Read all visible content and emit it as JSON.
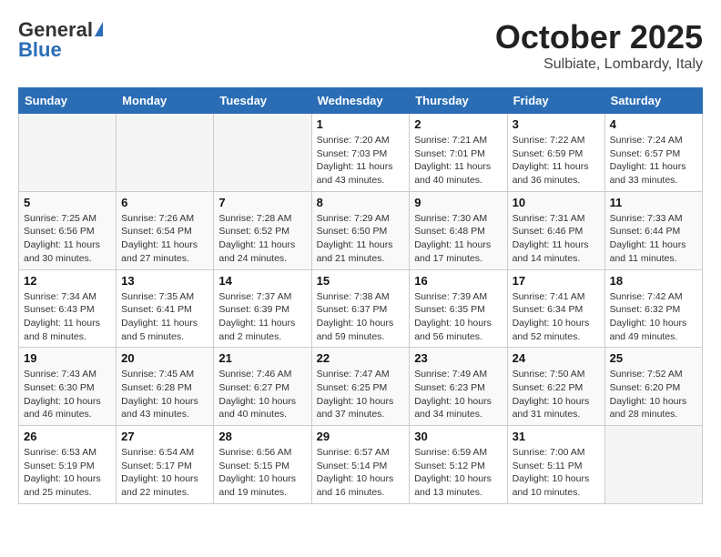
{
  "header": {
    "logo_general": "General",
    "logo_blue": "Blue",
    "month_title": "October 2025",
    "location": "Sulbiate, Lombardy, Italy"
  },
  "weekdays": [
    "Sunday",
    "Monday",
    "Tuesday",
    "Wednesday",
    "Thursday",
    "Friday",
    "Saturday"
  ],
  "weeks": [
    [
      {
        "day": "",
        "sunrise": "",
        "sunset": "",
        "daylight": ""
      },
      {
        "day": "",
        "sunrise": "",
        "sunset": "",
        "daylight": ""
      },
      {
        "day": "",
        "sunrise": "",
        "sunset": "",
        "daylight": ""
      },
      {
        "day": "1",
        "sunrise": "Sunrise: 7:20 AM",
        "sunset": "Sunset: 7:03 PM",
        "daylight": "Daylight: 11 hours and 43 minutes."
      },
      {
        "day": "2",
        "sunrise": "Sunrise: 7:21 AM",
        "sunset": "Sunset: 7:01 PM",
        "daylight": "Daylight: 11 hours and 40 minutes."
      },
      {
        "day": "3",
        "sunrise": "Sunrise: 7:22 AM",
        "sunset": "Sunset: 6:59 PM",
        "daylight": "Daylight: 11 hours and 36 minutes."
      },
      {
        "day": "4",
        "sunrise": "Sunrise: 7:24 AM",
        "sunset": "Sunset: 6:57 PM",
        "daylight": "Daylight: 11 hours and 33 minutes."
      }
    ],
    [
      {
        "day": "5",
        "sunrise": "Sunrise: 7:25 AM",
        "sunset": "Sunset: 6:56 PM",
        "daylight": "Daylight: 11 hours and 30 minutes."
      },
      {
        "day": "6",
        "sunrise": "Sunrise: 7:26 AM",
        "sunset": "Sunset: 6:54 PM",
        "daylight": "Daylight: 11 hours and 27 minutes."
      },
      {
        "day": "7",
        "sunrise": "Sunrise: 7:28 AM",
        "sunset": "Sunset: 6:52 PM",
        "daylight": "Daylight: 11 hours and 24 minutes."
      },
      {
        "day": "8",
        "sunrise": "Sunrise: 7:29 AM",
        "sunset": "Sunset: 6:50 PM",
        "daylight": "Daylight: 11 hours and 21 minutes."
      },
      {
        "day": "9",
        "sunrise": "Sunrise: 7:30 AM",
        "sunset": "Sunset: 6:48 PM",
        "daylight": "Daylight: 11 hours and 17 minutes."
      },
      {
        "day": "10",
        "sunrise": "Sunrise: 7:31 AM",
        "sunset": "Sunset: 6:46 PM",
        "daylight": "Daylight: 11 hours and 14 minutes."
      },
      {
        "day": "11",
        "sunrise": "Sunrise: 7:33 AM",
        "sunset": "Sunset: 6:44 PM",
        "daylight": "Daylight: 11 hours and 11 minutes."
      }
    ],
    [
      {
        "day": "12",
        "sunrise": "Sunrise: 7:34 AM",
        "sunset": "Sunset: 6:43 PM",
        "daylight": "Daylight: 11 hours and 8 minutes."
      },
      {
        "day": "13",
        "sunrise": "Sunrise: 7:35 AM",
        "sunset": "Sunset: 6:41 PM",
        "daylight": "Daylight: 11 hours and 5 minutes."
      },
      {
        "day": "14",
        "sunrise": "Sunrise: 7:37 AM",
        "sunset": "Sunset: 6:39 PM",
        "daylight": "Daylight: 11 hours and 2 minutes."
      },
      {
        "day": "15",
        "sunrise": "Sunrise: 7:38 AM",
        "sunset": "Sunset: 6:37 PM",
        "daylight": "Daylight: 10 hours and 59 minutes."
      },
      {
        "day": "16",
        "sunrise": "Sunrise: 7:39 AM",
        "sunset": "Sunset: 6:35 PM",
        "daylight": "Daylight: 10 hours and 56 minutes."
      },
      {
        "day": "17",
        "sunrise": "Sunrise: 7:41 AM",
        "sunset": "Sunset: 6:34 PM",
        "daylight": "Daylight: 10 hours and 52 minutes."
      },
      {
        "day": "18",
        "sunrise": "Sunrise: 7:42 AM",
        "sunset": "Sunset: 6:32 PM",
        "daylight": "Daylight: 10 hours and 49 minutes."
      }
    ],
    [
      {
        "day": "19",
        "sunrise": "Sunrise: 7:43 AM",
        "sunset": "Sunset: 6:30 PM",
        "daylight": "Daylight: 10 hours and 46 minutes."
      },
      {
        "day": "20",
        "sunrise": "Sunrise: 7:45 AM",
        "sunset": "Sunset: 6:28 PM",
        "daylight": "Daylight: 10 hours and 43 minutes."
      },
      {
        "day": "21",
        "sunrise": "Sunrise: 7:46 AM",
        "sunset": "Sunset: 6:27 PM",
        "daylight": "Daylight: 10 hours and 40 minutes."
      },
      {
        "day": "22",
        "sunrise": "Sunrise: 7:47 AM",
        "sunset": "Sunset: 6:25 PM",
        "daylight": "Daylight: 10 hours and 37 minutes."
      },
      {
        "day": "23",
        "sunrise": "Sunrise: 7:49 AM",
        "sunset": "Sunset: 6:23 PM",
        "daylight": "Daylight: 10 hours and 34 minutes."
      },
      {
        "day": "24",
        "sunrise": "Sunrise: 7:50 AM",
        "sunset": "Sunset: 6:22 PM",
        "daylight": "Daylight: 10 hours and 31 minutes."
      },
      {
        "day": "25",
        "sunrise": "Sunrise: 7:52 AM",
        "sunset": "Sunset: 6:20 PM",
        "daylight": "Daylight: 10 hours and 28 minutes."
      }
    ],
    [
      {
        "day": "26",
        "sunrise": "Sunrise: 6:53 AM",
        "sunset": "Sunset: 5:19 PM",
        "daylight": "Daylight: 10 hours and 25 minutes."
      },
      {
        "day": "27",
        "sunrise": "Sunrise: 6:54 AM",
        "sunset": "Sunset: 5:17 PM",
        "daylight": "Daylight: 10 hours and 22 minutes."
      },
      {
        "day": "28",
        "sunrise": "Sunrise: 6:56 AM",
        "sunset": "Sunset: 5:15 PM",
        "daylight": "Daylight: 10 hours and 19 minutes."
      },
      {
        "day": "29",
        "sunrise": "Sunrise: 6:57 AM",
        "sunset": "Sunset: 5:14 PM",
        "daylight": "Daylight: 10 hours and 16 minutes."
      },
      {
        "day": "30",
        "sunrise": "Sunrise: 6:59 AM",
        "sunset": "Sunset: 5:12 PM",
        "daylight": "Daylight: 10 hours and 13 minutes."
      },
      {
        "day": "31",
        "sunrise": "Sunrise: 7:00 AM",
        "sunset": "Sunset: 5:11 PM",
        "daylight": "Daylight: 10 hours and 10 minutes."
      },
      {
        "day": "",
        "sunrise": "",
        "sunset": "",
        "daylight": ""
      }
    ]
  ]
}
